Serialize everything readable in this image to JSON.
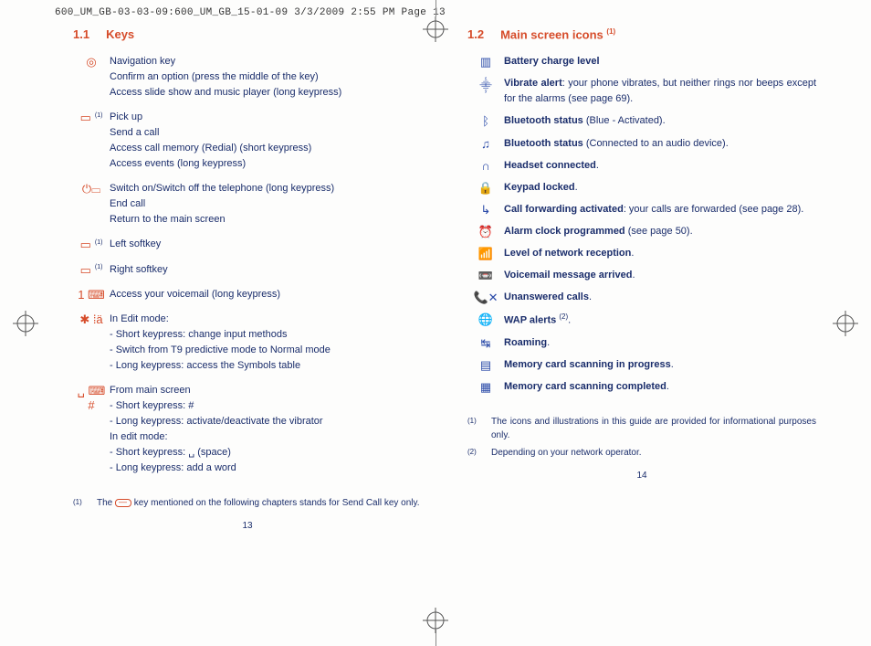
{
  "header": "600_UM_GB-03-03-09:600_UM_GB_15-01-09  3/3/2009  2:55 PM  Page 13",
  "left": {
    "num": "1.1",
    "title": "Keys",
    "items": [
      {
        "icon": "nav-key-icon",
        "glyph": "◎",
        "lines": [
          "Navigation key",
          "Confirm an option (press the middle of the key)",
          "Access slide show and music player (long keypress)"
        ]
      },
      {
        "icon": "pickup-key-icon",
        "glyph": "▭",
        "sup": "(1)",
        "lines": [
          "Pick up",
          "Send a call",
          "Access call memory (Redial) (short keypress)",
          "Access events (long keypress)"
        ]
      },
      {
        "icon": "power-key-icon",
        "glyph": "⏻▭",
        "lines": [
          "Switch on/Switch off the telephone (long keypress)",
          "End call",
          "Return to the main screen"
        ]
      },
      {
        "icon": "left-softkey-icon",
        "glyph": "▭",
        "sup": "(1)",
        "lines": [
          "Left softkey"
        ]
      },
      {
        "icon": "right-softkey-icon",
        "glyph": "▭",
        "sup": "(1)",
        "lines": [
          "Right softkey"
        ]
      },
      {
        "icon": "voicemail-key-icon",
        "glyph": "1 ⌨",
        "lines": [
          "Access your voicemail (long keypress)"
        ]
      },
      {
        "icon": "star-key-icon",
        "glyph": "✱ ⁞ä",
        "lines": [
          "In Edit mode:",
          "- Short keypress: change input methods",
          "- Switch from T9 predictive mode to Normal mode",
          "- Long keypress: access the Symbols table"
        ]
      },
      {
        "icon": "hash-key-icon",
        "glyph": "␣ ⌨ #",
        "lines": [
          "From main screen",
          "- Short keypress: #",
          "- Long keypress: activate/deactivate the vibrator",
          "In edit mode:",
          "- Short keypress: ␣ (space)",
          "- Long keypress: add a word"
        ]
      }
    ],
    "footnotes": [
      {
        "sup": "(1)",
        "text_pre": "The ",
        "text_post": " key mentioned on the following chapters stands for Send Call key only."
      }
    ],
    "pagenum": "13"
  },
  "right": {
    "num": "1.2",
    "title": "Main screen icons",
    "title_sup": "(1)",
    "items": [
      {
        "icon": "battery-icon",
        "glyph": "▥",
        "html": "<b>Battery charge level</b>"
      },
      {
        "icon": "vibrate-icon",
        "glyph": "⸎",
        "html": "<b>Vibrate alert</b>: your phone vibrates, but neither rings nor beeps except for the alarms (see page 69)."
      },
      {
        "icon": "bluetooth-activated-icon",
        "glyph": "ᛒ",
        "html": "<b>Bluetooth status</b> (Blue - Activated)."
      },
      {
        "icon": "bluetooth-audio-icon",
        "glyph": "♫",
        "html": "<b>Bluetooth status</b> (Connected to an audio device)."
      },
      {
        "icon": "headset-icon",
        "glyph": "∩",
        "html": "<b>Headset connected</b>."
      },
      {
        "icon": "keypad-locked-icon",
        "glyph": "🔒",
        "html": "<b>Keypad locked</b>."
      },
      {
        "icon": "call-forward-icon",
        "glyph": "↳",
        "html": "<b>Call forwarding activated</b>: your calls are forwarded (see page 28)."
      },
      {
        "icon": "alarm-icon",
        "glyph": "⏰",
        "html": "<b>Alarm clock programmed</b> (see page 50)."
      },
      {
        "icon": "signal-icon",
        "glyph": "📶",
        "html": "<b>Level of network reception</b>."
      },
      {
        "icon": "voicemail-icon",
        "glyph": "📼",
        "html": "<b>Voicemail message arrived</b>."
      },
      {
        "icon": "missed-call-icon",
        "glyph": "📞✕",
        "html": "<b>Unanswered calls</b>."
      },
      {
        "icon": "wap-icon",
        "glyph": "🌐",
        "html": "<b>WAP alerts</b> <span class='sup'>(2)</span>."
      },
      {
        "icon": "roaming-icon",
        "glyph": "↹",
        "html": "<b>Roaming</b>."
      },
      {
        "icon": "card-scan-progress-icon",
        "glyph": "▤",
        "html": "<b>Memory card scanning in progress</b>."
      },
      {
        "icon": "card-scan-done-icon",
        "glyph": "▦",
        "html": "<b>Memory card scanning completed</b>."
      }
    ],
    "footnotes": [
      {
        "sup": "(1)",
        "text": "The icons and illustrations in this guide are provided for informational purposes only."
      },
      {
        "sup": "(2)",
        "text": "Depending on your network operator."
      }
    ],
    "pagenum": "14"
  }
}
